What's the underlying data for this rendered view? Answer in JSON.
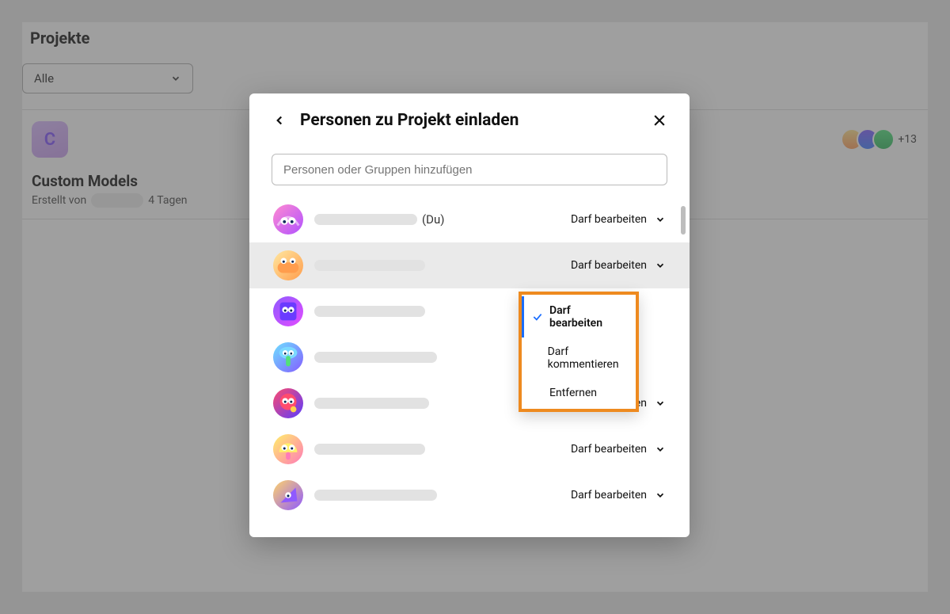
{
  "page": {
    "title": "Projekte",
    "filter_label": "Alle"
  },
  "project": {
    "tile_letter": "C",
    "name": "Custom Models",
    "created_prefix": "Erstellt von",
    "created_suffix": "4 Tagen",
    "collab_more": "+13"
  },
  "modal": {
    "title": "Personen zu Projekt einladen",
    "search_placeholder": "Personen oder Gruppen hinzufügen",
    "you_suffix": "(Du)",
    "perm_label": "Darf bearbeiten"
  },
  "dropdown": {
    "edit": "Darf bearbeiten",
    "comment": "Darf kommentieren",
    "remove": "Entfernen"
  }
}
